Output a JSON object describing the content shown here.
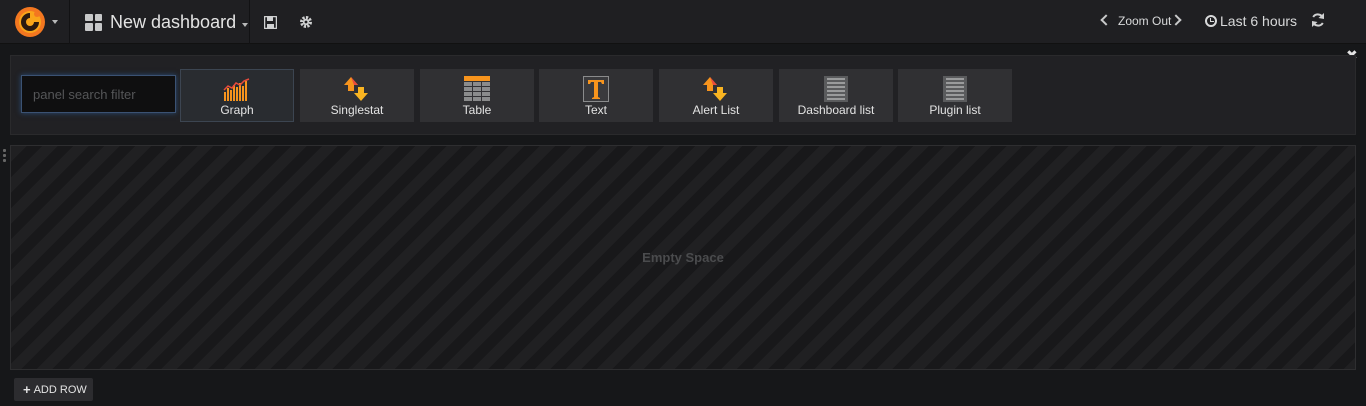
{
  "navbar": {
    "dashboard_title": "New dashboard",
    "zoom_out": "Zoom Out",
    "time_range": "Last 6 hours"
  },
  "picker": {
    "search_placeholder": "panel search filter",
    "panels": [
      {
        "label": "Graph",
        "icon": "graph-icon",
        "selected": true
      },
      {
        "label": "Singlestat",
        "icon": "singlestat-icon",
        "selected": false
      },
      {
        "label": "Table",
        "icon": "table-icon",
        "selected": false
      },
      {
        "label": "Text",
        "icon": "text-icon",
        "selected": false
      },
      {
        "label": "Alert List",
        "icon": "alert-list-icon",
        "selected": false
      },
      {
        "label": "Dashboard list",
        "icon": "dashboard-list-icon",
        "selected": false
      },
      {
        "label": "Plugin list",
        "icon": "plugin-list-icon",
        "selected": false
      }
    ]
  },
  "empty_space": {
    "label": "Empty Space"
  },
  "add_row": {
    "label": "ADD ROW"
  },
  "colors": {
    "accent_orange": "#f7941d",
    "background": "#161719",
    "panel": "#212124"
  }
}
